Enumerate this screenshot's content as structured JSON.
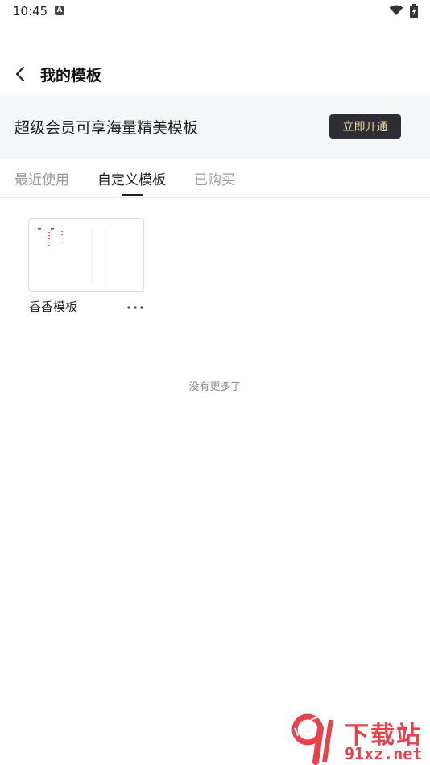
{
  "status_bar": {
    "time": "10:45",
    "notification_letter": "A"
  },
  "header": {
    "title": "我的模板"
  },
  "banner": {
    "text": "超级会员可享海量精美模板",
    "button_label": "立即开通"
  },
  "tabs": [
    {
      "label": "最近使用",
      "active": false
    },
    {
      "label": "自定义模板",
      "active": true
    },
    {
      "label": "已购买",
      "active": false
    }
  ],
  "templates": [
    {
      "name": "香香模板"
    }
  ],
  "list_footer": "没有更多了",
  "watermark": {
    "brand": "下载站",
    "domain": "91xz.net"
  },
  "colors": {
    "accent_button_bg": "#2c2e33",
    "accent_button_text": "#f0d6a4",
    "watermark": "#e8424d"
  }
}
